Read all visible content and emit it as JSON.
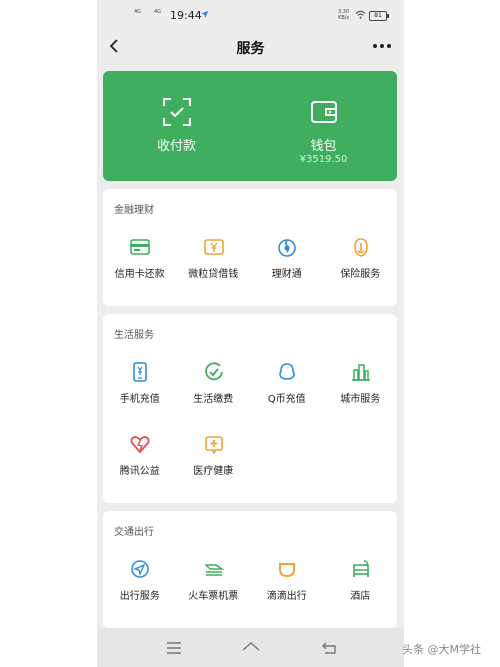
{
  "status_bar": {
    "network1": "4G",
    "network2": "4G",
    "time": "19:44",
    "speed_value": "3.30",
    "speed_unit": "KB/s",
    "battery": "81"
  },
  "nav": {
    "title": "服务"
  },
  "wallet_card": {
    "pay": {
      "label": "收付款",
      "icon": "scan-check-icon"
    },
    "wallet": {
      "label": "钱包",
      "balance": "¥3519.50",
      "icon": "wallet-icon"
    }
  },
  "sections": {
    "finance": {
      "title": "金融理财",
      "items": [
        {
          "label": "信用卡还款",
          "icon": "credit-card-icon",
          "color": "#3fae5f"
        },
        {
          "label": "微粒贷借钱",
          "icon": "loan-icon",
          "color": "#f0a33a"
        },
        {
          "label": "理财通",
          "icon": "wealth-icon",
          "color": "#2f8ee0"
        },
        {
          "label": "保险服务",
          "icon": "insurance-icon",
          "color": "#f0a33a"
        }
      ]
    },
    "life": {
      "title": "生活服务",
      "items": [
        {
          "label": "手机充值",
          "icon": "phone-topup-icon",
          "color": "#2f8ee0"
        },
        {
          "label": "生活缴费",
          "icon": "bill-pay-icon",
          "color": "#3fae5f"
        },
        {
          "label": "Q币充值",
          "icon": "qq-coin-icon",
          "color": "#2f8ee0"
        },
        {
          "label": "城市服务",
          "icon": "city-service-icon",
          "color": "#3fae5f"
        },
        {
          "label": "腾讯公益",
          "icon": "charity-heart-icon",
          "color": "#e05050"
        },
        {
          "label": "医疗健康",
          "icon": "medical-icon",
          "color": "#f0a33a"
        }
      ]
    },
    "travel": {
      "title": "交通出行",
      "items": [
        {
          "label": "出行服务",
          "icon": "travel-compass-icon",
          "color": "#2f8ee0"
        },
        {
          "label": "火车票机票",
          "icon": "train-plane-icon",
          "color": "#3fae5f"
        },
        {
          "label": "滴滴出行",
          "icon": "didi-icon",
          "color": "#f0a33a"
        },
        {
          "label": "酒店",
          "icon": "hotel-bed-icon",
          "color": "#3fae5f"
        }
      ]
    }
  },
  "watermark": "头条 @大M学社"
}
